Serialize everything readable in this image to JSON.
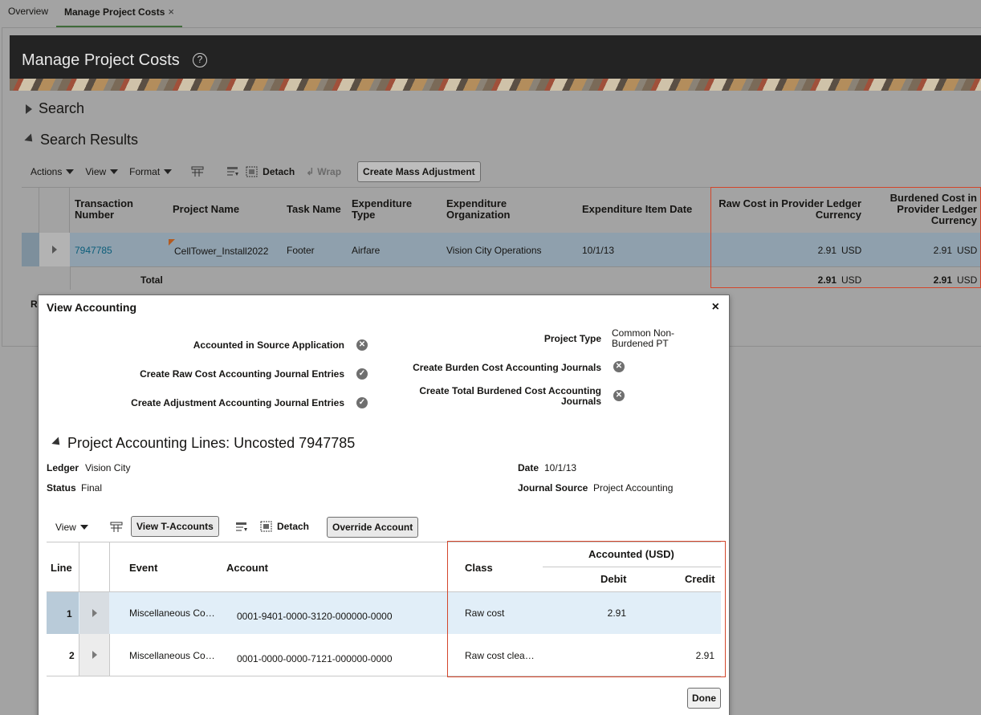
{
  "tabs": [
    {
      "label": "Overview"
    },
    {
      "label": "Manage Project Costs",
      "close": "×"
    }
  ],
  "page": {
    "title": "Manage Project Costs",
    "help": "?"
  },
  "search": {
    "label": "Search"
  },
  "results": {
    "label": "Search Results",
    "toolbar": {
      "actions": "Actions",
      "view": "View",
      "format": "Format",
      "detach": "Detach",
      "wrap": "Wrap",
      "mass_adjust": "Create Mass Adjustment"
    },
    "columns": {
      "txn": "Transaction Number",
      "project": "Project Name",
      "task": "Task Name",
      "exp_type": "Expenditure Type",
      "exp_org": "Expenditure Organization",
      "item_date": "Expenditure Item Date",
      "raw_cost": "Raw Cost in Provider Ledger Currency",
      "burdened_cost": "Burdened Cost in Provider Ledger Currency"
    },
    "row": {
      "txn": "7947785",
      "project": "CellTower_Install2022",
      "task": "Footer",
      "exp_type": "Airfare",
      "exp_org": "Vision City Operations",
      "item_date": "10/1/13",
      "raw_cost": "2.91",
      "raw_cur": "USD",
      "burdened_cost": "2.91",
      "burdened_cur": "USD"
    },
    "total": {
      "label": "Total",
      "raw_cost": "2.91",
      "raw_cur": "USD",
      "burdened_cost": "2.91",
      "burdened_cur": "USD"
    },
    "partial_label": "R"
  },
  "dialog": {
    "title": "View Accounting",
    "close": "×",
    "flags": {
      "accounted_source": "Accounted in Source Application",
      "raw_journals": "Create Raw Cost Accounting Journal Entries",
      "adj_journals": "Create Adjustment Accounting Journal Entries",
      "project_type_label": "Project Type",
      "project_type_value": "Common Non-Burdened PT",
      "burden_journals": "Create Burden Cost Accounting Journals",
      "total_burdened_journals": "Create Total Burdened Cost Accounting Journals"
    },
    "lines_section": "Project Accounting Lines: Uncosted 7947785",
    "ledger_label": "Ledger",
    "ledger_value": "Vision City",
    "status_label": "Status",
    "status_value": "Final",
    "date_label": "Date",
    "date_value": "10/1/13",
    "source_label": "Journal Source",
    "source_value": "Project Accounting",
    "toolbar": {
      "view": "View",
      "t_accounts": "View T-Accounts",
      "detach": "Detach",
      "override": "Override Account"
    },
    "columns": {
      "line": "Line",
      "event": "Event",
      "account": "Account",
      "class": "Class",
      "accounted": "Accounted (USD)",
      "debit": "Debit",
      "credit": "Credit"
    },
    "rows": [
      {
        "line": "1",
        "event": "Miscellaneous Co…",
        "account": "0001-9401-0000-3120-000000-0000",
        "class": "Raw cost",
        "debit": "2.91",
        "credit": ""
      },
      {
        "line": "2",
        "event": "Miscellaneous Co…",
        "account": "0001-0000-0000-7121-000000-0000",
        "class": "Raw cost clea…",
        "debit": "",
        "credit": "2.91"
      }
    ],
    "done": "Done"
  }
}
